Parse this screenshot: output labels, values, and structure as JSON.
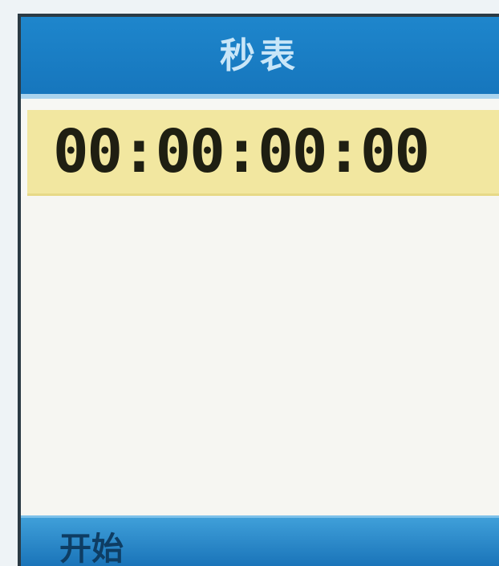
{
  "app": {
    "title": "秒表"
  },
  "timer": {
    "display": "00:00:00:00"
  },
  "softkeys": {
    "left_label": "开始"
  },
  "colors": {
    "title_bar": "#1676bd",
    "timer_band": "#f2e7a0",
    "softkey_bar": "#1a74b9",
    "content_bg": "#f6f6f2"
  }
}
